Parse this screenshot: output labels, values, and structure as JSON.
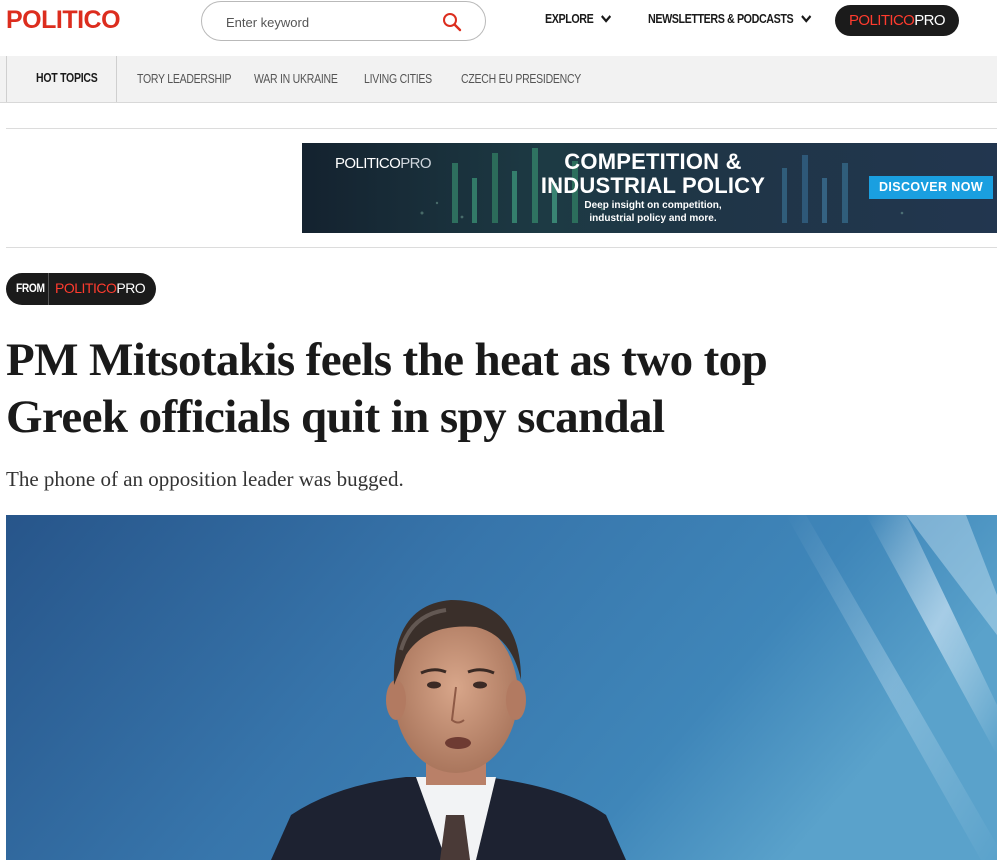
{
  "header": {
    "logo": "POLITICO",
    "search": {
      "placeholder": "Enter keyword",
      "icon": "search-icon"
    },
    "nav": [
      {
        "label": "EXPLORE",
        "icon": "chevron-down-icon"
      },
      {
        "label": "NEWSLETTERS & PODCASTS",
        "icon": "chevron-down-icon"
      }
    ],
    "pro_button": {
      "brand": "POLITICO",
      "suffix": "PRO"
    }
  },
  "topics": {
    "label": "HOT TOPICS",
    "items": [
      "TORY LEADERSHIP",
      "WAR IN UKRAINE",
      "LIVING CITIES",
      "CZECH EU PRESIDENCY"
    ]
  },
  "ad": {
    "brand": "POLITICO",
    "brand_suffix": "PRO",
    "title_line1": "COMPETITION &",
    "title_line2": "INDUSTRIAL POLICY",
    "subtitle_line1": "Deep insight on competition,",
    "subtitle_line2": "industrial policy and more.",
    "cta": "DISCOVER NOW"
  },
  "article": {
    "source_prefix": "FROM",
    "source_brand": "POLITICO",
    "source_suffix": "PRO",
    "headline_line1": "PM Mitsotakis feels the heat as two top",
    "headline_line2": "Greek officials quit in spy scandal",
    "dek": "The phone of an opposition leader was bugged."
  },
  "colors": {
    "brand_red": "#dc2d1e",
    "pill_dark": "#1b1b1b",
    "cta_blue": "#1a9fe0",
    "topics_bg": "#f2f2f2"
  }
}
